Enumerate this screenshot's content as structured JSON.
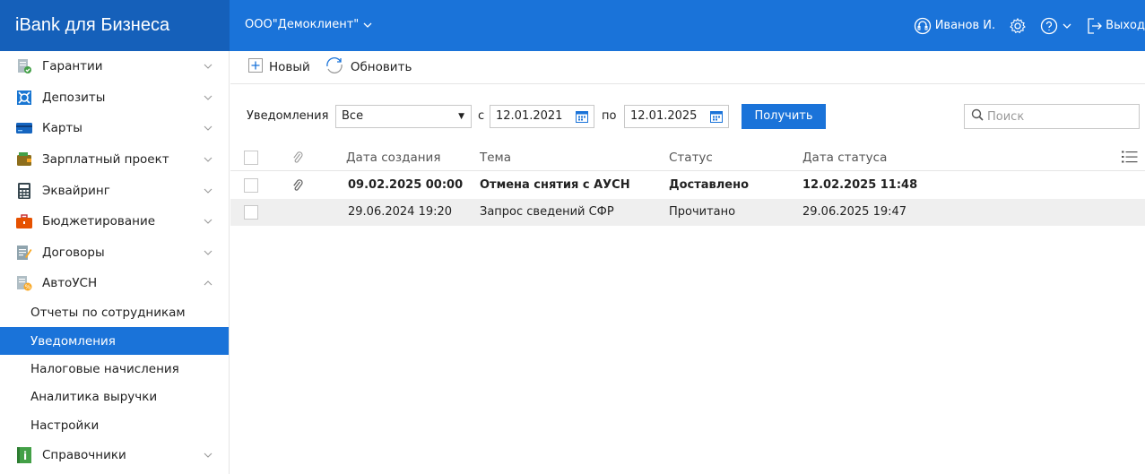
{
  "header": {
    "brand": "iBank для Бизнеса",
    "org_name": "ООО\"Демоклиент\"",
    "user_name": "Иванов И.",
    "logout_label": "Выход"
  },
  "sidebar": {
    "items": [
      {
        "label": "Гарантии",
        "icon": "guarantee-icon"
      },
      {
        "label": "Депозиты",
        "icon": "deposit-icon"
      },
      {
        "label": "Карты",
        "icon": "card-icon"
      },
      {
        "label": "Зарплатный проект",
        "icon": "wallet-icon"
      },
      {
        "label": "Эквайринг",
        "icon": "calculator-icon"
      },
      {
        "label": "Бюджетирование",
        "icon": "briefcase-icon"
      },
      {
        "label": "Договоры",
        "icon": "contract-icon"
      },
      {
        "label": "АвтоУСН",
        "icon": "tax-icon"
      }
    ],
    "subitems": [
      {
        "label": "Отчеты по сотрудникам"
      },
      {
        "label": "Уведомления"
      },
      {
        "label": "Налоговые начисления"
      },
      {
        "label": "Аналитика выручки"
      },
      {
        "label": "Настройки"
      }
    ],
    "bottom_item": {
      "label": "Справочники",
      "icon": "directory-icon"
    }
  },
  "toolbar": {
    "new_label": "Новый",
    "refresh_label": "Обновить"
  },
  "filter": {
    "label": "Уведомления",
    "type_value": "Все",
    "from_label": "с",
    "from_date": "12.01.2021",
    "to_label": "по",
    "to_date": "12.01.2025",
    "get_label": "Получить",
    "search_placeholder": "Поиск"
  },
  "table": {
    "columns": [
      "Дата создания",
      "Тема",
      "Статус",
      "Дата статуса"
    ],
    "rows": [
      {
        "created": "09.02.2025 00:00",
        "subject": "Отмена снятия с АУСН",
        "status": "Доставлено",
        "status_date": "12.02.2025 11:48",
        "has_attachment": true,
        "unread": true
      },
      {
        "created": "29.06.2024 19:20",
        "subject": "Запрос сведений СФР",
        "status": "Прочитано",
        "status_date": "29.06.2025 19:47",
        "has_attachment": false,
        "unread": false
      }
    ]
  },
  "colors": {
    "accent": "#1a73d9",
    "brand_bg": "#1560ba",
    "active_row": "#efefef"
  }
}
